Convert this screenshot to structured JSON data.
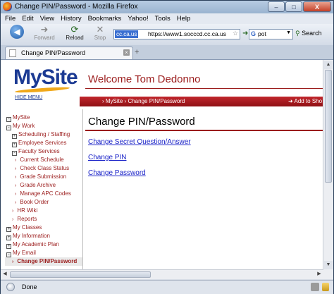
{
  "window": {
    "title": "Change PIN/Password - Mozilla Firefox",
    "controls": {
      "minimize": "–",
      "maximize": "□",
      "close": "X"
    }
  },
  "menubar": [
    "File",
    "Edit",
    "View",
    "History",
    "Bookmarks",
    "Yahoo!",
    "Tools",
    "Help"
  ],
  "navbar": {
    "back": "Back",
    "forward": "Forward",
    "reload": "Reload",
    "stop": "Stop",
    "site_identity": "cc.ca.us",
    "url": "https://www1.socccd.cc.ca.us",
    "search_query": "pot",
    "search_button": "Search"
  },
  "tabs": [
    {
      "label": "Change PIN/Password"
    }
  ],
  "site": {
    "logo": "MySite",
    "hide_menu": "HIDE MENU",
    "welcome": "Welcome Tom Dedonno",
    "breadcrumb": "› MySite › Change PIN/Password",
    "add_shortcuts": "➜ Add to Sho"
  },
  "leftnav": [
    {
      "label": "MySite",
      "level": 1,
      "marker": "box"
    },
    {
      "label": "My Work",
      "level": 1,
      "marker": "box"
    },
    {
      "label": "Scheduling / Staffing",
      "level": 2,
      "marker": "box"
    },
    {
      "label": "Employee Services",
      "level": 2,
      "marker": "box"
    },
    {
      "label": "Faculty Services",
      "level": 2,
      "marker": "box"
    },
    {
      "label": "Current Schedule",
      "level": 3,
      "marker": "arrow"
    },
    {
      "label": "Check Class Status",
      "level": 3,
      "marker": "arrow"
    },
    {
      "label": "Grade Submission",
      "level": 3,
      "marker": "arrow"
    },
    {
      "label": "Grade Archive",
      "level": 3,
      "marker": "arrow"
    },
    {
      "label": "Manage APC Codes",
      "level": 3,
      "marker": "arrow"
    },
    {
      "label": "Book Order",
      "level": 3,
      "marker": "arrow"
    },
    {
      "label": "HR Wiki",
      "level": 2,
      "marker": "arrow"
    },
    {
      "label": "Reports",
      "level": 2,
      "marker": "arrow"
    },
    {
      "label": "My Classes",
      "level": 1,
      "marker": "box"
    },
    {
      "label": "My Information",
      "level": 1,
      "marker": "box"
    },
    {
      "label": "My Academic Plan",
      "level": 1,
      "marker": "box"
    },
    {
      "label": "My Email",
      "level": 1,
      "marker": "box"
    },
    {
      "label": "Change PIN/Password",
      "level": 2,
      "marker": "arrow",
      "active": true
    }
  ],
  "main": {
    "heading": "Change PIN/Password",
    "links": [
      "Change Secret Question/Answer",
      "Change PIN",
      "Change Password"
    ]
  },
  "status": {
    "text": "Done"
  },
  "colors": {
    "brand_red": "#9b1c1c",
    "brand_blue": "#1b3a93",
    "link_blue": "#1b23c8",
    "logo_swoosh": "#f0a81a"
  }
}
